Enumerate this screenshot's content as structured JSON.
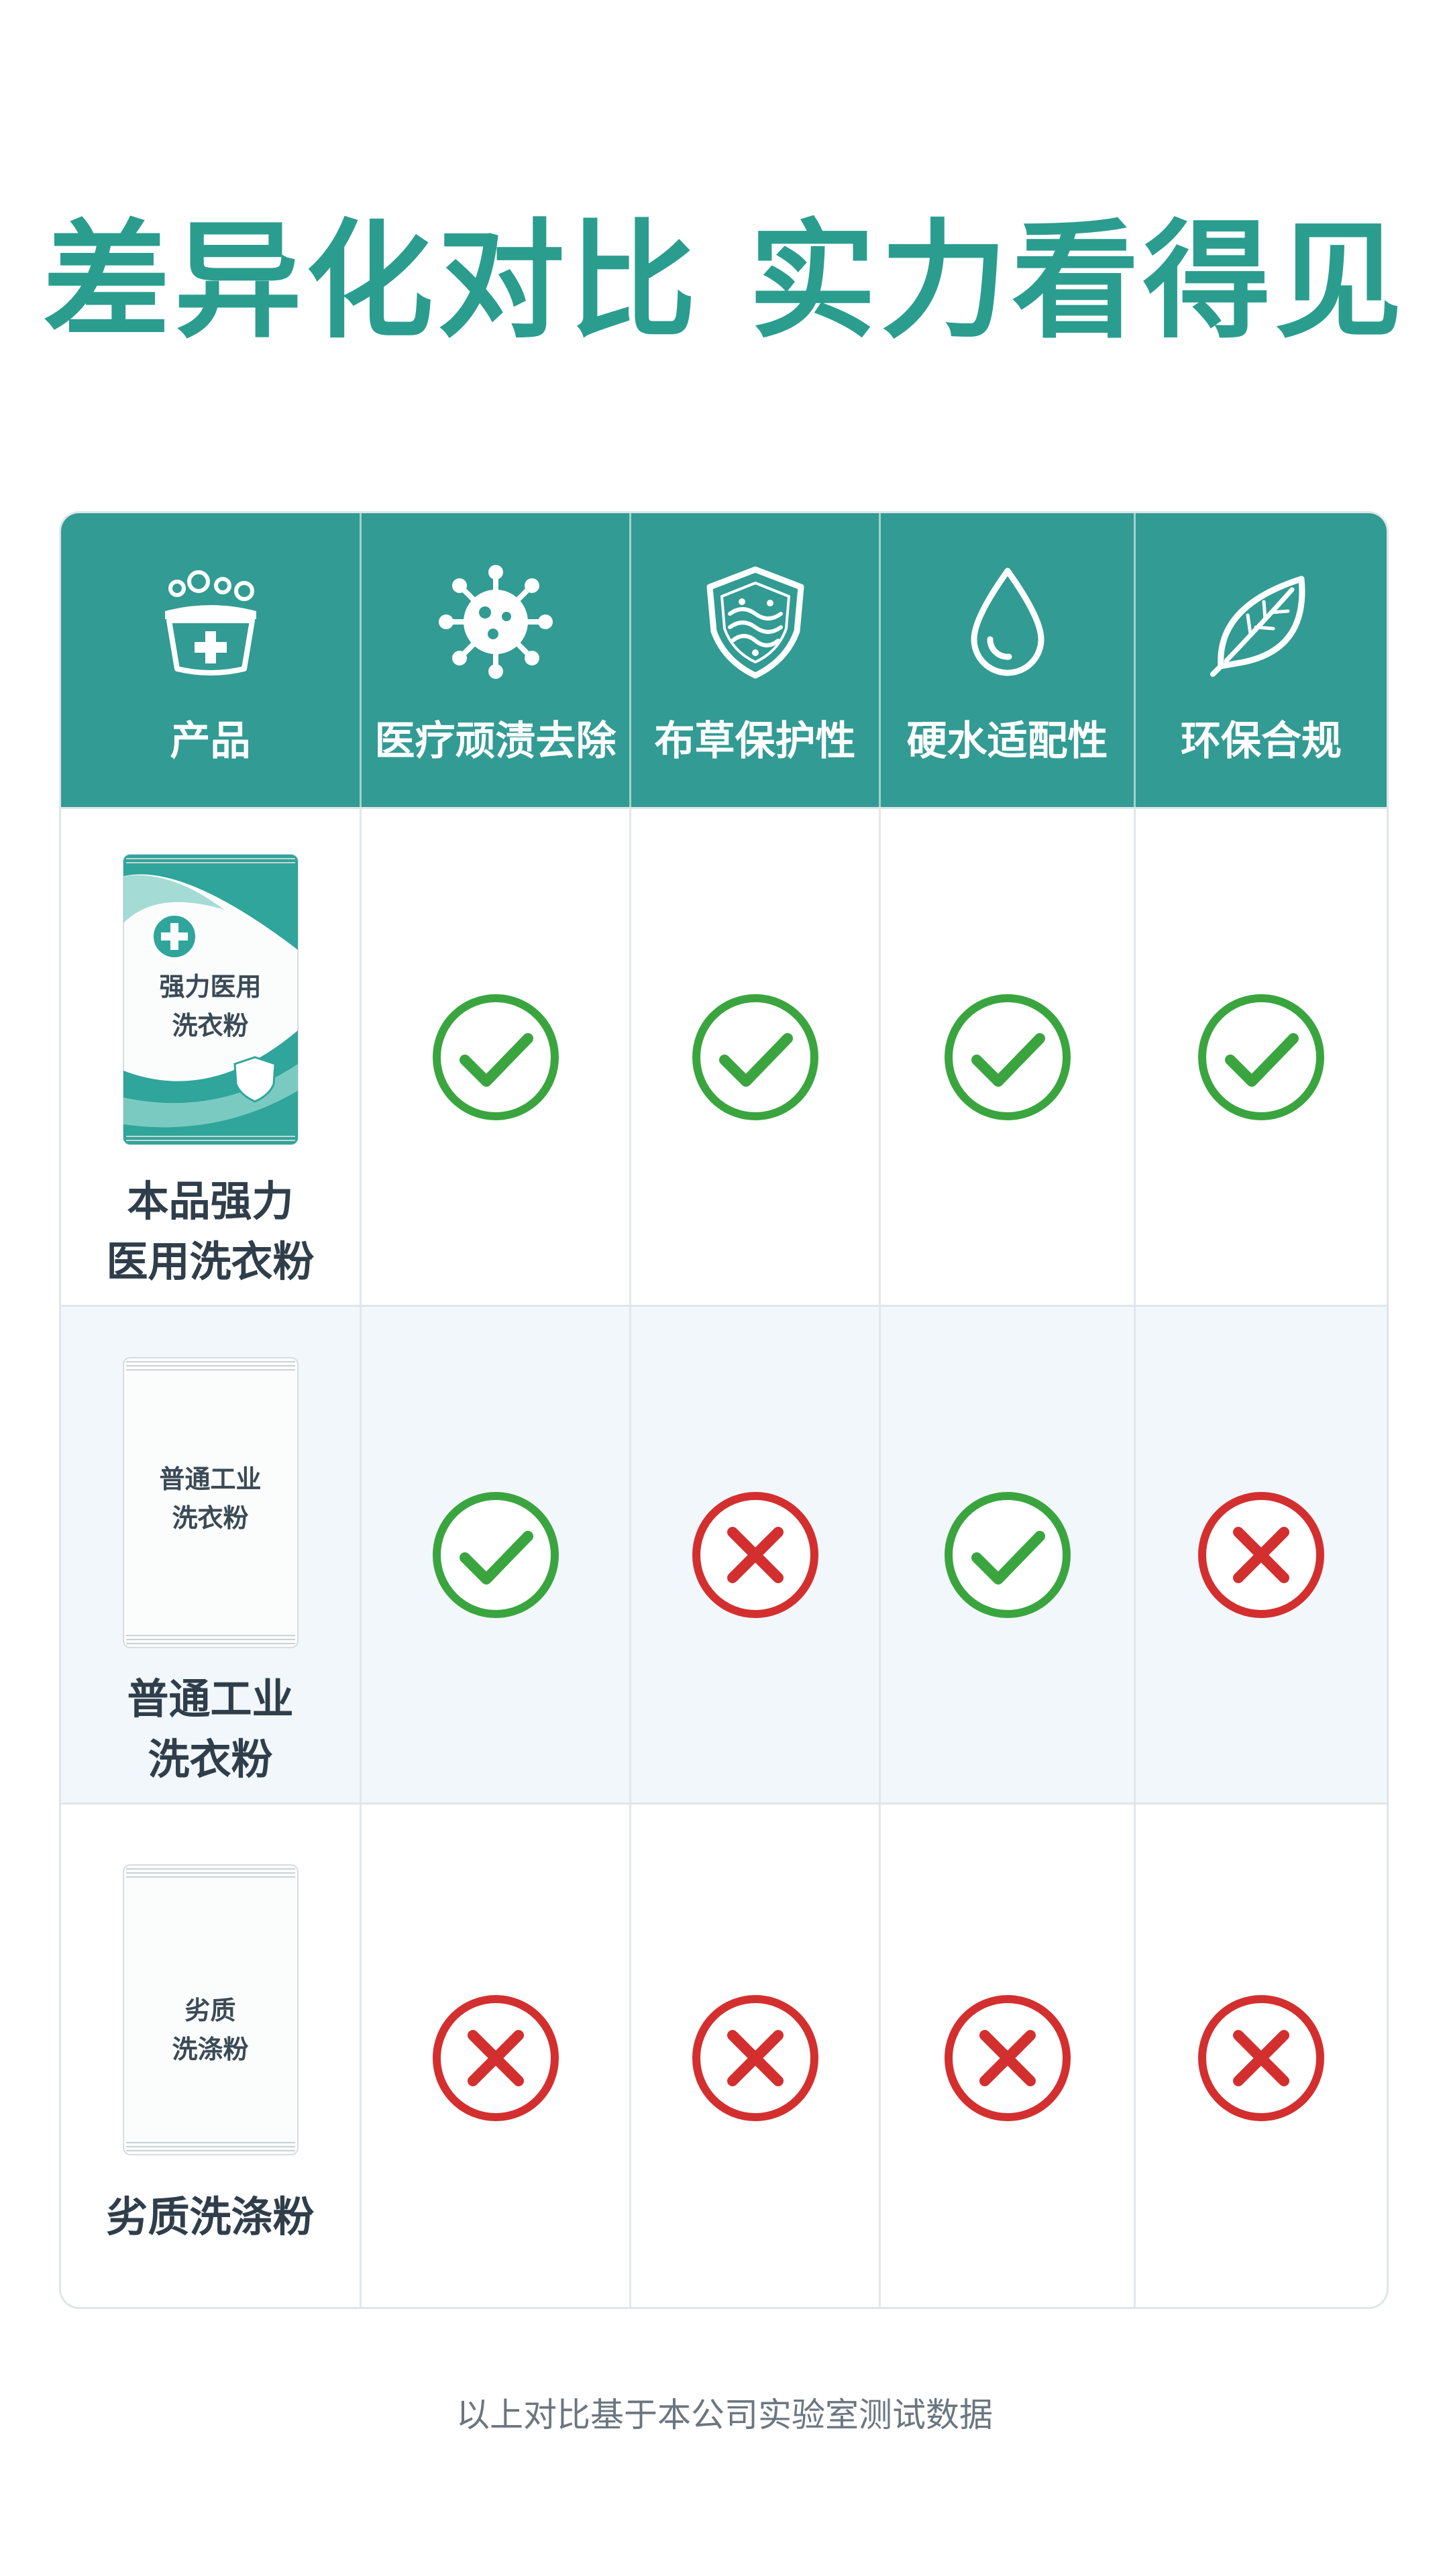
{
  "title": "差异化对比 实力看得见",
  "colors": {
    "brand_teal": "#329b93",
    "title_teal": "#2a9d8f",
    "check_green": "#3aa53f",
    "cross_red": "#d32f2f"
  },
  "header": {
    "columns": [
      {
        "label": "产品",
        "icon": "basin-plus-icon"
      },
      {
        "label": "医疗顽渍去除",
        "icon": "virus-icon"
      },
      {
        "label": "布草保护性",
        "icon": "shield-fabric-icon"
      },
      {
        "label": "硬水适配性",
        "icon": "water-drop-icon"
      },
      {
        "label": "环保合规",
        "icon": "leaf-icon"
      }
    ]
  },
  "rows": [
    {
      "pack_lines": [
        "强力医用",
        "洗衣粉"
      ],
      "name_lines": [
        "本品强力",
        "医用洗衣粉"
      ],
      "results": [
        "check",
        "check",
        "check",
        "check"
      ]
    },
    {
      "pack_lines": [
        "普通工业",
        "洗衣粉"
      ],
      "name_lines": [
        "普通工业",
        "洗衣粉"
      ],
      "results": [
        "check",
        "cross",
        "check",
        "cross"
      ]
    },
    {
      "pack_lines": [
        "劣质",
        "洗涤粉"
      ],
      "name_lines": [
        "劣质洗涤粉"
      ],
      "results": [
        "cross",
        "cross",
        "cross",
        "cross"
      ]
    }
  ],
  "footnote": "以上对比基于本公司实验室测试数据"
}
